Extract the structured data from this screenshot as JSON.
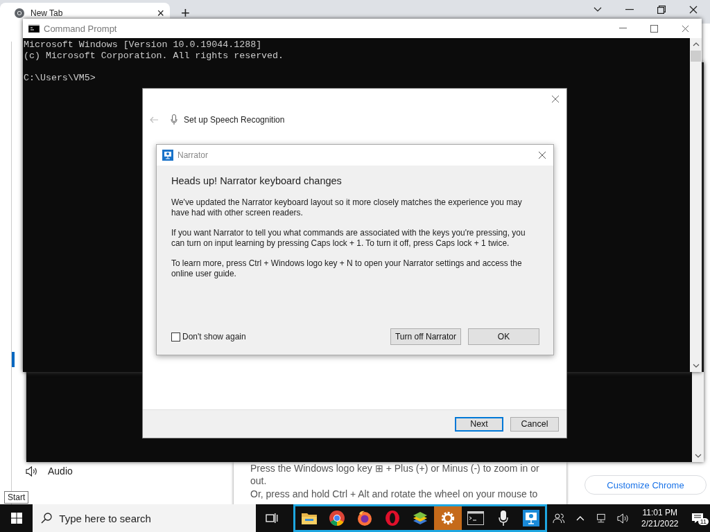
{
  "browser": {
    "tab": {
      "title": "New Tab",
      "close": "×"
    },
    "new_tab": "+"
  },
  "settings": {
    "nav_items": [
      {
        "label": "Audio",
        "selected": false
      }
    ],
    "zoom_help": [
      "Press the Windows logo key ⊞ + Plus (+) or Minus (-) to zoom in or out.",
      "Or, press and hold Ctrl + Alt and rotate the wheel on your mouse to"
    ],
    "customize_button": "Customize Chrome"
  },
  "command_prompt": {
    "title": "Command Prompt",
    "output": [
      "Microsoft Windows [Version 10.0.19044.1288]",
      "(c) Microsoft Corporation. All rights reserved."
    ],
    "prompt": "C:\\Users\\VM5>"
  },
  "speech_wizard": {
    "title": "Set up Speech Recognition",
    "buttons": [
      {
        "label": "Next",
        "default": true
      },
      {
        "label": "Cancel",
        "default": false
      }
    ]
  },
  "narrator_dialog": {
    "title": "Narrator",
    "heading": "Heads up! Narrator keyboard changes",
    "paragraphs": [
      "We've updated the Narrator keyboard layout so it more closely matches the experience you may have had with other screen readers.",
      "If you want Narrator to tell you what commands are associated with the keys you're pressing, you can turn on input learning by pressing Caps lock + 1. To turn it off, press Caps lock + 1 twice.",
      "To learn more, press Ctrl + Windows logo key + N to open your Narrator settings and access the online user guide."
    ],
    "checkbox": {
      "label": "Don't show again",
      "checked": false
    },
    "buttons": [
      {
        "label": "Turn off Narrator"
      },
      {
        "label": "OK"
      }
    ]
  },
  "tooltip": "Start",
  "taskbar": {
    "search": {
      "placeholder": "Type here to search"
    },
    "apps": [
      {
        "kind": "folder",
        "active": false
      },
      {
        "kind": "chrome",
        "active": false
      },
      {
        "kind": "firefox",
        "active": false
      },
      {
        "kind": "opera",
        "active": false
      },
      {
        "kind": "bluestacks",
        "active": false
      },
      {
        "kind": "settings",
        "active": true
      },
      {
        "kind": "console",
        "active": false
      },
      {
        "kind": "microphone",
        "active": false
      },
      {
        "kind": "narrator",
        "active": false
      }
    ],
    "time": "11:01 PM",
    "date": "2/21/2022",
    "notification_count": "11"
  }
}
